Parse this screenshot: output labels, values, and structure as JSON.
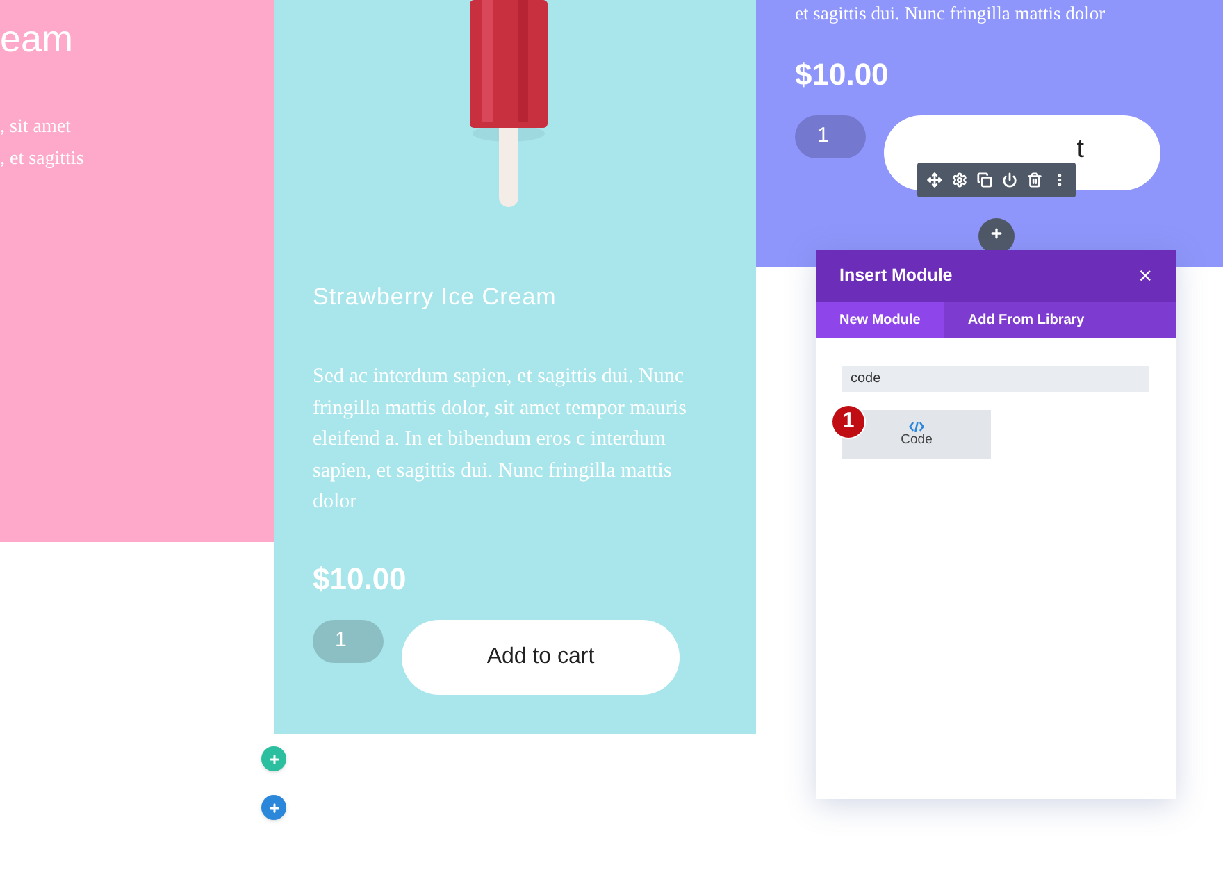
{
  "left_card": {
    "title": "eam",
    "description_lines": [
      ", sit amet",
      ", et sagittis"
    ]
  },
  "center_card": {
    "title": "Strawberry Ice Cream",
    "description": "Sed ac interdum sapien, et sagittis dui. Nunc fringilla mattis dolor, sit amet tempor mauris eleifend a. In et bibendum eros c interdum sapien, et sagittis dui. Nunc fringilla mattis dolor",
    "price": "$10.00",
    "quantity": "1",
    "add_to_cart": "Add to cart"
  },
  "right_card": {
    "description_tail": "et sagittis dui. Nunc fringilla mattis dolor",
    "price": "$10.00",
    "quantity": "1",
    "add_to_cart": "t"
  },
  "insert_module": {
    "title": "Insert Module",
    "close": "×",
    "tabs": [
      {
        "label": "New Module",
        "selected": true
      },
      {
        "label": "Add From Library",
        "selected": false
      }
    ],
    "search_value": "code",
    "results": [
      {
        "label": "Code",
        "badge": "1"
      }
    ]
  }
}
